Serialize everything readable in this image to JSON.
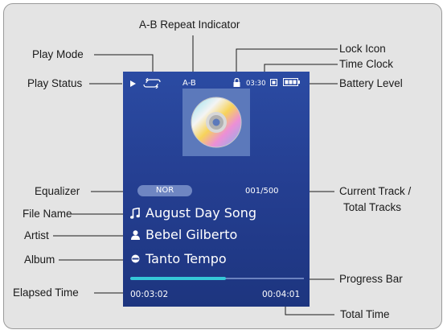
{
  "callouts": {
    "ab_repeat_indicator": "A-B Repeat Indicator",
    "play_mode": "Play Mode",
    "lock_icon": "Lock Icon",
    "time_clock": "Time Clock",
    "play_status": "Play Status",
    "battery_level": "Battery Level",
    "equalizer": "Equalizer",
    "current_track_line1": "Current Track /",
    "current_track_line2": "Total Tracks",
    "file_name": "File Name",
    "artist": "Artist",
    "album": "Album",
    "progress_bar": "Progress Bar",
    "elapsed_time": "Elapsed Time",
    "total_time": "Total Time"
  },
  "screen": {
    "ab_repeat": "A-B",
    "clock": "03:30",
    "equalizer_mode": "NOR",
    "track_counter": "001/500",
    "file_name": "August Day Song",
    "artist": "Bebel Gilberto",
    "album": "Tanto Tempo",
    "elapsed": "00:03:02",
    "total": "00:04:01",
    "progress_fraction": 0.55
  },
  "icons": {
    "play_status": "play-triangle-icon",
    "play_mode": "repeat-mode-icon",
    "lock": "lock-icon",
    "battery": "battery-icon",
    "file": "music-note-icon",
    "artist": "person-icon",
    "album": "album-disc-icon",
    "album_art": "compact-disc-icon"
  },
  "colors": {
    "screen_blue": "#2846a0",
    "progress_fill": "#35c8d8",
    "panel_gray": "#e4e4e4"
  }
}
